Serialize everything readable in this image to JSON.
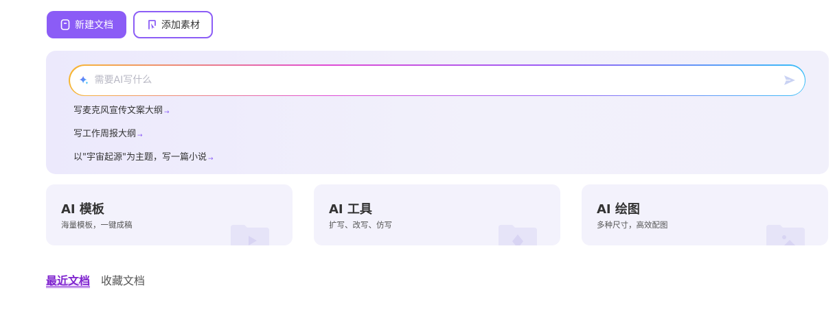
{
  "toolbar": {
    "new_doc_label": "新建文档",
    "add_material_label": "添加素材"
  },
  "ai_input": {
    "placeholder": "需要AI写什么"
  },
  "suggestions": [
    "写麦克风宣传文案大纲",
    "写工作周报大纲",
    "以\"宇宙起源\"为主题，写一篇小说"
  ],
  "cards": [
    {
      "title": "AI 模板",
      "desc": "海量模板，一键成稿",
      "icon": "template-icon"
    },
    {
      "title": "AI 工具",
      "desc": "扩写、改写、仿写",
      "icon": "tools-icon"
    },
    {
      "title": "AI 绘图",
      "desc": "多种尺寸，高效配图",
      "icon": "image-icon"
    }
  ],
  "tabs": {
    "recent": "最近文档",
    "favorites": "收藏文档"
  },
  "colors": {
    "accent": "#8b5cf6",
    "active_tab": "#7e22ce",
    "panel_bg": "#efedfb"
  }
}
